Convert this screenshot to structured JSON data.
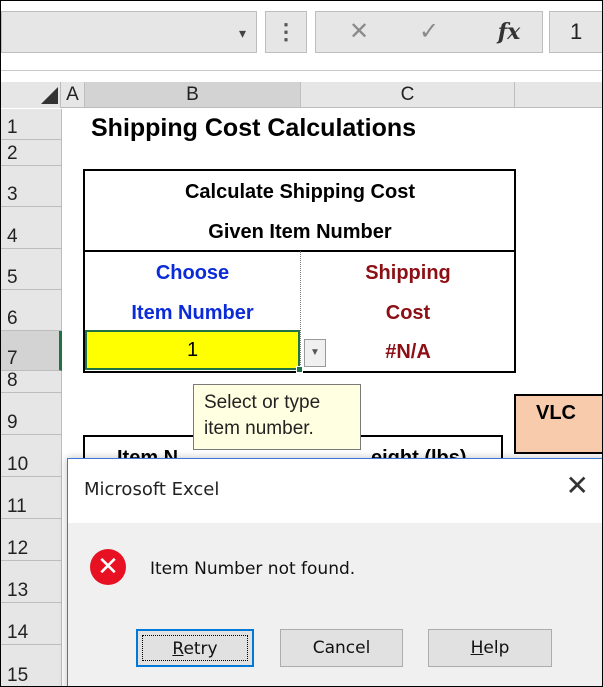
{
  "formula_bar": {
    "name_box_caret": "▾",
    "menu_dots": "⋮",
    "cancel_glyph": "✕",
    "enter_glyph": "✓",
    "fx_label": "fx",
    "formula_value": "1"
  },
  "columns": [
    "A",
    "B",
    "C"
  ],
  "rows": [
    "1",
    "2",
    "3",
    "4",
    "5",
    "6",
    "7",
    "8",
    "9",
    "10",
    "11",
    "12",
    "13",
    "14",
    "15"
  ],
  "sheet": {
    "title": "Shipping Cost Calculations",
    "calc_header_line1": "Calculate Shipping Cost",
    "calc_header_line2": "Given Item Number",
    "choose_line1": "Choose",
    "choose_line2": "Item Number",
    "shipping_line1": "Shipping",
    "shipping_line2": "Cost",
    "selected_value": "1",
    "result_value": "#N/A",
    "tooltip_line1": "Select or type",
    "tooltip_line2": "item number.",
    "vlookup_label": "VLC",
    "partial_header_1": "Item N",
    "partial_header_2": "eight (lbs)"
  },
  "dialog": {
    "title": "Microsoft Excel",
    "close_glyph": "✕",
    "error_glyph": "✕",
    "message": "Item Number not found.",
    "retry_first": "R",
    "retry_rest": "etry",
    "cancel_label": "Cancel",
    "help_first": "H",
    "help_rest": "elp"
  },
  "colors": {
    "accent_green": "#217346",
    "input_yellow": "#ffff00",
    "blue_text": "#0b2bd8",
    "red_text": "#8b0f14",
    "vlookup_fill": "#f8cbad",
    "error_red": "#e81123"
  }
}
